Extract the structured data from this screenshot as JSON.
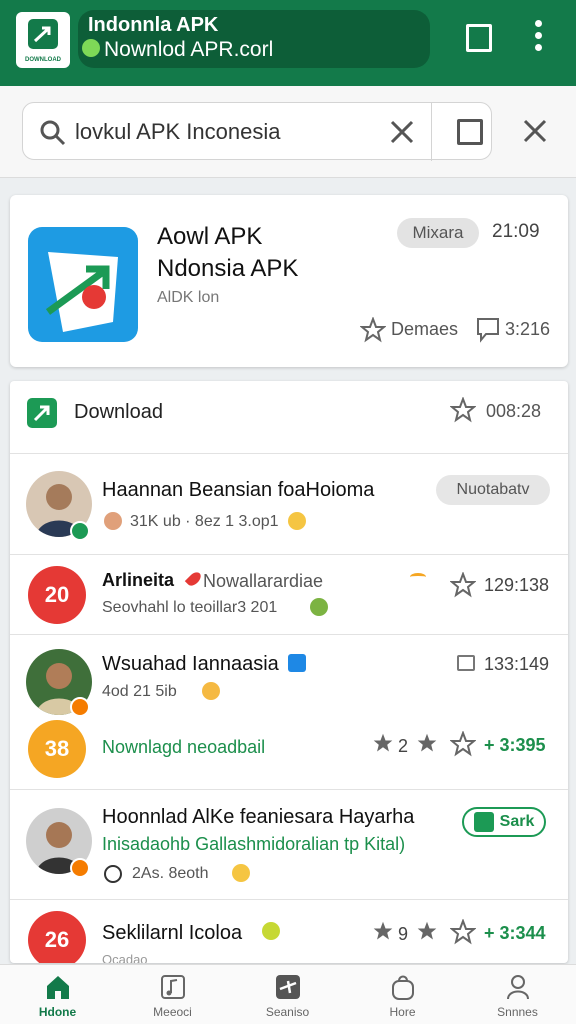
{
  "colors": {
    "brand": "#137a4a",
    "accent_green": "#1c9a55",
    "icon_blue": "#1e9be3"
  },
  "browser": {
    "title": "Indonnla APK",
    "url": "Nownlod APR.corl",
    "logo_text": "DOWNLOAD"
  },
  "search": {
    "value": "lovkul APK Inconesia",
    "placeholder": "lovkul APK Inconesia"
  },
  "app_card": {
    "title_line1": "Aowl APK",
    "title_line2": "Ndonsia APK",
    "subtitle": "AlDK lon",
    "chip": "Mixara",
    "time": "21:09",
    "favorites": "Demaes",
    "comments": "3:216"
  },
  "list": {
    "header": {
      "label": "Download",
      "time": "008:28"
    },
    "rows": [
      {
        "title": "Haannan Beansian foaHoioma",
        "meta": "31K ub · 8ez 1 3.op1",
        "chip": "Nuotabatv"
      },
      {
        "avatar_text": "20",
        "name": "Arlineita",
        "title": "Nowallarardiae",
        "meta": "Seovhahl lo teoillar3 201",
        "time": "129:138"
      },
      {
        "title": "Wsuahad Iannaasia",
        "meta": "4od 21 5ib",
        "time": "133:149"
      },
      {
        "avatar_text": "38",
        "title": "Nownlagd neoadbail",
        "stars": "2",
        "score": "+ 3:395"
      },
      {
        "title": "Hoonnlad AlKe feaniesara Hayarha",
        "subtitle": "Inisadaohb Gallashmidoralian tp Kital)",
        "meta": "2As. 8eoth",
        "chip": "Sark"
      },
      {
        "avatar_text": "26",
        "title": "Seklilarnl Icoloa",
        "stars": "9",
        "score": "+ 3:344",
        "meta": "Ocadao"
      }
    ]
  },
  "bottom_nav": [
    {
      "label": "Hdone",
      "icon": "home-icon",
      "active": true
    },
    {
      "label": "Meeoci",
      "icon": "music-icon",
      "active": false
    },
    {
      "label": "Seaniso",
      "icon": "plane-icon",
      "active": false
    },
    {
      "label": "Hore",
      "icon": "bag-icon",
      "active": false
    },
    {
      "label": "Snnnes",
      "icon": "person-icon",
      "active": false
    }
  ]
}
